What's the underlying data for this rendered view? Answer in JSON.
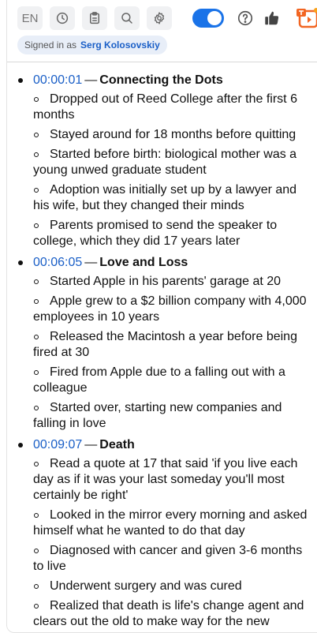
{
  "toolbar": {
    "lang_label": "EN",
    "icons": [
      "history-icon",
      "clipboard-icon",
      "search-icon",
      "gear-icon",
      "help-icon",
      "thumbs-up-icon",
      "app-logo-icon"
    ],
    "toggle_on": true,
    "accent_color": "#1a73e8"
  },
  "signed": {
    "prefix": "Signed in as",
    "user": "Serg Kolosovskiy"
  },
  "sections": [
    {
      "timestamp": "00:00:01",
      "dash": "—",
      "title": "Connecting the Dots",
      "points": [
        "Dropped out of Reed College after the first 6 months",
        "Stayed around for 18 months before quitting",
        "Started before birth: biological mother was a young unwed graduate student",
        "Adoption was initially set up by a lawyer and his wife, but they changed their minds",
        "Parents promised to send the speaker to college, which they did 17 years later"
      ]
    },
    {
      "timestamp": "00:06:05",
      "dash": "—",
      "title": "Love and Loss",
      "points": [
        "Started Apple in his parents' garage at 20",
        "Apple grew to a $2 billion company with 4,000 employees in 10 years",
        "Released the Macintosh a year before being fired at 30",
        "Fired from Apple due to a falling out with a colleague",
        "Started over, starting new companies and falling in love"
      ]
    },
    {
      "timestamp": "00:09:07",
      "dash": "—",
      "title": "Death",
      "points": [
        "Read a quote at 17 that said 'if you live each day as if it was your last someday you'll most certainly be right'",
        "Looked in the mirror every morning and asked himself what he wanted to do that day",
        "Diagnosed with cancer and given 3-6 months to live",
        "Underwent surgery and was cured",
        "Realized that death is life's change agent and clears out the old to make way for the new"
      ]
    }
  ]
}
